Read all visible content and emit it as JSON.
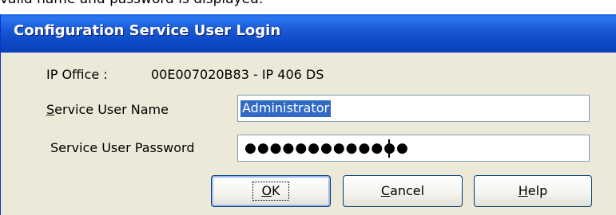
{
  "caption": "valid name and password is displayed.",
  "dialog": {
    "title": "Configuration Service User Login",
    "ip_label": "IP Office :",
    "ip_value": "00E007020B83 - IP 406 DS",
    "name_label_accel": "S",
    "name_label_rest": "ervice User Name",
    "name_value": "Administrator",
    "password_label": "Service User Password",
    "password_mask": "●●●●●●●●●●●●●",
    "ok_label_accel": "O",
    "ok_label_rest": "K",
    "cancel_label_accel": "C",
    "cancel_label_rest": "ancel",
    "help_label_accel": "H",
    "help_label_rest": "elp"
  },
  "colors": {
    "titlebar": "#0a4ec2",
    "dialog_bg": "#ece9d8",
    "selection": "#316ac5"
  }
}
